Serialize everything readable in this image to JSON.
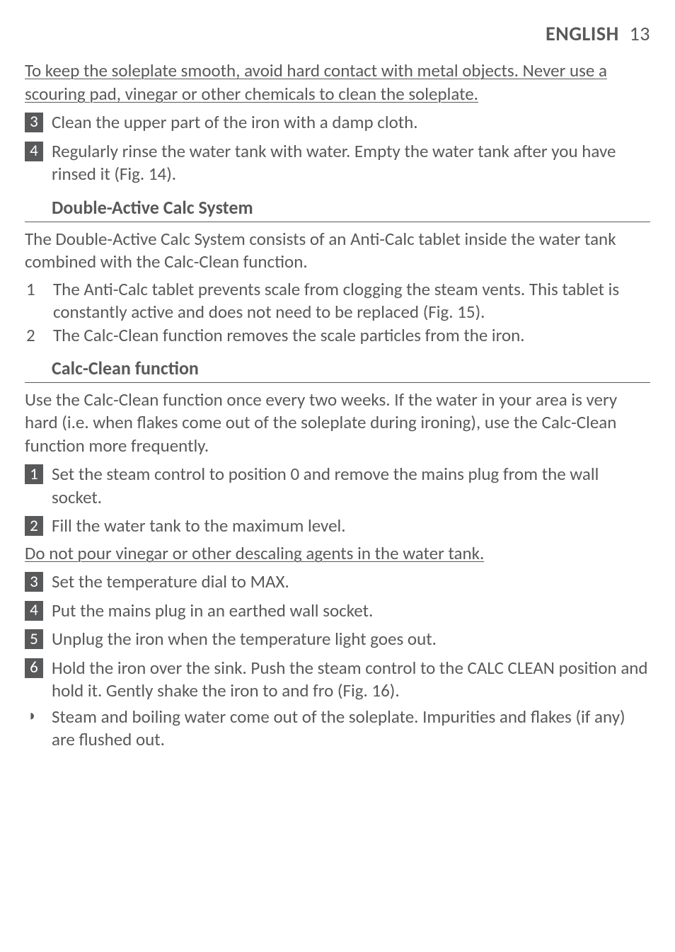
{
  "header": {
    "language": "ENGLISH",
    "page_number": "13"
  },
  "warning_soleplate": "To keep the soleplate smooth, avoid hard contact with metal objects. Never use a scouring pad, vinegar or other chemicals to clean the soleplate.",
  "steps_top": [
    {
      "num": "3",
      "text": "Clean the upper part of the iron with a damp cloth."
    },
    {
      "num": "4",
      "text": "Regularly rinse the water tank with water. Empty the water tank after you have rinsed it (Fig. 14)."
    }
  ],
  "section_dacs": {
    "title": "Double-Active Calc System",
    "intro": "The Double-Active Calc System consists of an Anti-Calc tablet inside the water tank combined with the Calc-Clean function.",
    "items": [
      {
        "n": "1",
        "t": "The Anti-Calc tablet prevents scale from clogging the steam vents. This tablet is constantly active and does not need to be replaced (Fig. 15)."
      },
      {
        "n": "2",
        "t": "The Calc-Clean function removes the scale particles from the iron."
      }
    ]
  },
  "section_cc": {
    "title": "Calc-Clean function",
    "intro": "Use the Calc-Clean function once every two weeks. If the water in your area is very hard (i.e. when flakes come out of the soleplate during ironing), use the Calc-Clean function more frequently.",
    "steps_a": [
      {
        "num": "1",
        "text": "Set the steam control to position 0 and remove the mains plug from the wall socket."
      },
      {
        "num": "2",
        "text": "Fill the water tank to the maximum level."
      }
    ],
    "warning": "Do not pour vinegar or other descaling agents in the water tank.",
    "steps_b": [
      {
        "num": "3",
        "text": "Set the temperature dial to MAX."
      },
      {
        "num": "4",
        "text": "Put the mains plug in an earthed wall socket."
      },
      {
        "num": "5",
        "text": "Unplug the iron when the temperature light goes out."
      },
      {
        "num": "6",
        "text": "Hold the iron over the sink. Push the steam control to the CALC CLEAN position and hold it. Gently shake the iron to and fro (Fig. 16)."
      }
    ],
    "result": "Steam and boiling water come out of the soleplate. Impurities and flakes (if any) are flushed out."
  }
}
